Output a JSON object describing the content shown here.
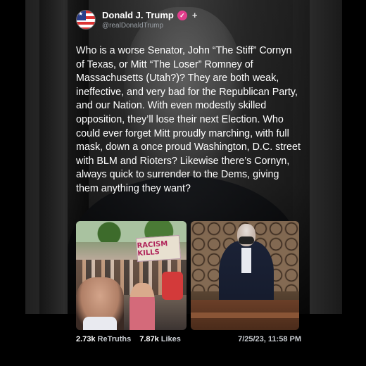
{
  "post": {
    "author": {
      "name": "Donald J. Trump",
      "handle": "@realDonaldTrump",
      "avatar_icon": "american-flag-avatar",
      "verified_icon": "verified-check-icon",
      "follow_glyph": "+"
    },
    "body": "Who is a worse Senator, John “The Stiff” Cornyn of Texas, or Mitt “The Loser” Romney of Massachusetts (Utah?)? They are both weak, ineffective, and very bad for the Republican Party, and our Nation. With even modestly skilled opposition, they’ll lose their next Election. Who could ever forget Mitt proudly marching, with full mask, down a once proud Washington, D.C. street with BLM and Rioters? Likewise there’s Cornyn, always quick to surrender to the Dems, giving them anything they want?",
    "media": {
      "image1": {
        "sign_text": "RACISM KILLS"
      },
      "image2": {}
    },
    "stats": {
      "retruths_count": "2.73k",
      "retruths_label": "ReTruths",
      "likes_count": "7.87k",
      "likes_label": "Likes",
      "timestamp": "7/25/23, 11:58 PM"
    }
  },
  "colors": {
    "background": "#000000",
    "verified_badge": "#e23d8c",
    "secondary_text": "#c9cdd2"
  }
}
